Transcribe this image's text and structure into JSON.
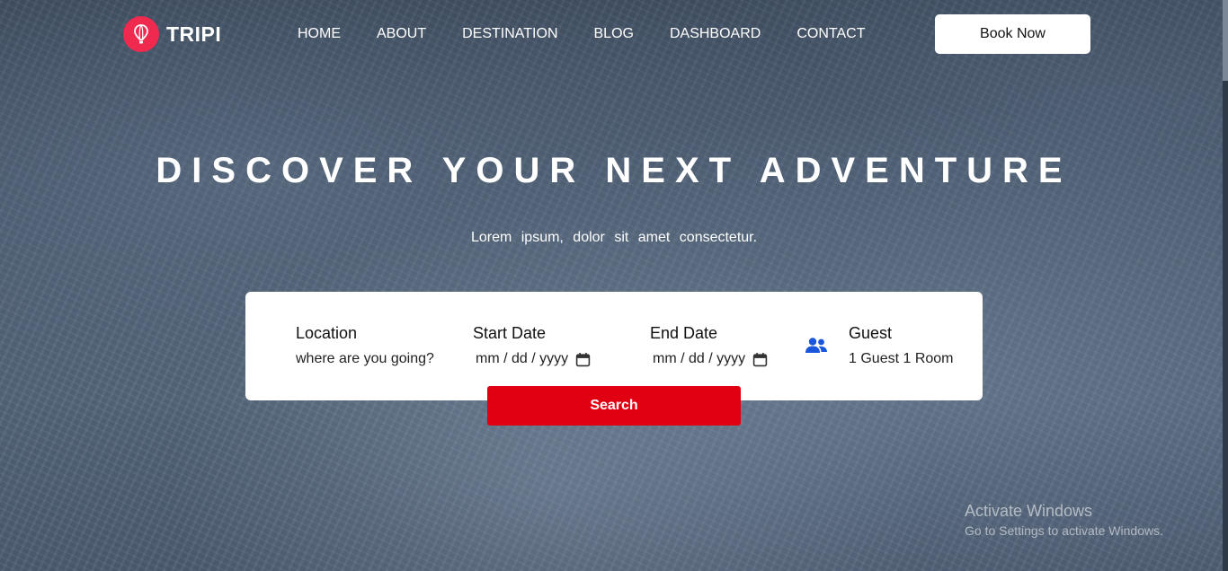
{
  "brand": {
    "name": "TRIPI",
    "logo_icon": "hot-air-balloon-icon",
    "logo_color": "#f0294f"
  },
  "nav": {
    "items": [
      {
        "label": "HOME"
      },
      {
        "label": "ABOUT"
      },
      {
        "label": "DESTINATION"
      },
      {
        "label": "BLOG"
      },
      {
        "label": "DASHBOARD"
      },
      {
        "label": "CONTACT"
      }
    ],
    "book_label": "Book Now"
  },
  "hero": {
    "title": "DISCOVER YOUR NEXT ADVENTURE",
    "subtitle": "Lorem ipsum, dolor sit amet consectetur."
  },
  "search": {
    "location": {
      "label": "Location",
      "placeholder": "where are you going?"
    },
    "start_date": {
      "label": "Start Date",
      "placeholder": "mm / dd / yyyy",
      "icon": "calendar-icon"
    },
    "end_date": {
      "label": "End Date",
      "placeholder": "mm / dd / yyyy",
      "icon": "calendar-icon"
    },
    "guest": {
      "label": "Guest",
      "value": "1 Guest 1 Room",
      "icon": "users-icon",
      "icon_color": "#1a56db"
    },
    "button_label": "Search",
    "button_color": "#e10012"
  },
  "watermark": {
    "title": "Activate Windows",
    "subtitle": "Go to Settings to activate Windows."
  }
}
